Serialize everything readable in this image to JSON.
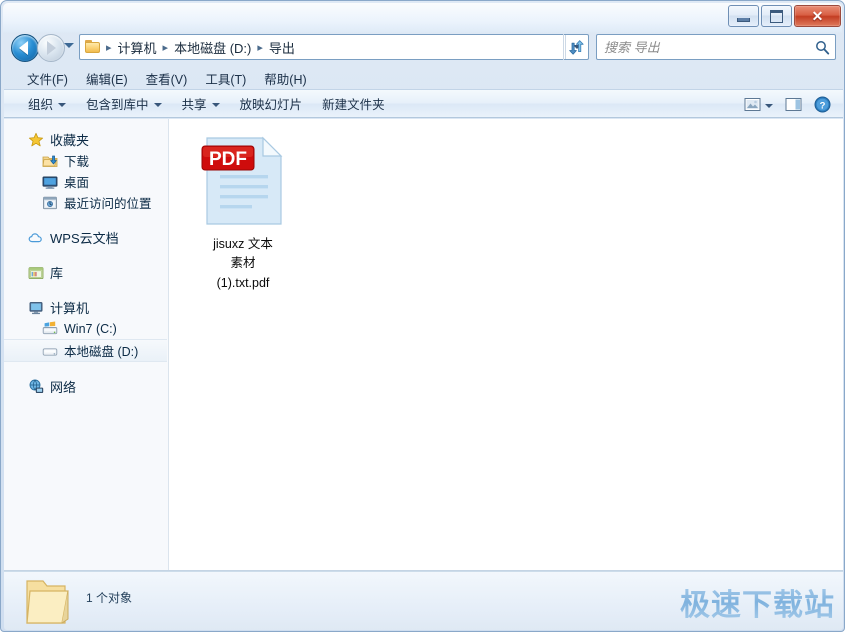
{
  "window": {
    "buttons": {
      "minimize": "minimize-button",
      "maximize": "maximize-button",
      "close_glyph": "✕"
    }
  },
  "nav": {
    "back_tooltip": "后退",
    "forward_tooltip": "前进",
    "history_tooltip": "最近浏览的页面",
    "refresh_tooltip": "刷新"
  },
  "address": {
    "crumbs": [
      "计算机",
      "本地磁盘 (D:)",
      "导出"
    ],
    "separator": "▸"
  },
  "search": {
    "placeholder": "搜索 导出",
    "value": ""
  },
  "menubar": {
    "items": [
      {
        "label": "文件(F)"
      },
      {
        "label": "编辑(E)"
      },
      {
        "label": "查看(V)"
      },
      {
        "label": "工具(T)"
      },
      {
        "label": "帮助(H)"
      }
    ]
  },
  "commandbar": {
    "items": [
      {
        "label": "组织",
        "has_chevron": true
      },
      {
        "label": "包含到库中",
        "has_chevron": true
      },
      {
        "label": "共享",
        "has_chevron": true
      },
      {
        "label": "放映幻灯片",
        "has_chevron": false
      },
      {
        "label": "新建文件夹",
        "has_chevron": false
      }
    ],
    "right": {
      "view_icon": "change-view-icon",
      "view_chevron": true,
      "preview_pane_icon": "preview-pane-icon",
      "help_icon": "help-icon"
    }
  },
  "navpane": {
    "groups": [
      {
        "name": "favorites",
        "nodes": [
          {
            "label": "收藏夹",
            "icon": "star-icon",
            "level": 0,
            "selected": false
          },
          {
            "label": "下载",
            "icon": "downloads-folder-icon",
            "level": 1,
            "selected": false
          },
          {
            "label": "桌面",
            "icon": "desktop-icon",
            "level": 1,
            "selected": false
          },
          {
            "label": "最近访问的位置",
            "icon": "recent-places-icon",
            "level": 1,
            "selected": false
          }
        ]
      },
      {
        "name": "wps-cloud",
        "nodes": [
          {
            "label": "WPS云文档",
            "icon": "cloud-icon",
            "level": 0,
            "selected": false
          }
        ]
      },
      {
        "name": "libraries",
        "nodes": [
          {
            "label": "库",
            "icon": "library-icon",
            "level": 0,
            "selected": false
          }
        ]
      },
      {
        "name": "computer",
        "nodes": [
          {
            "label": "计算机",
            "icon": "computer-icon",
            "level": 0,
            "selected": false
          },
          {
            "label": "Win7 (C:)",
            "icon": "system-drive-icon",
            "level": 1,
            "selected": false
          },
          {
            "label": "本地磁盘 (D:)",
            "icon": "drive-icon",
            "level": 1,
            "selected": true
          }
        ]
      },
      {
        "name": "network",
        "nodes": [
          {
            "label": "网络",
            "icon": "network-icon",
            "level": 0,
            "selected": false
          }
        ]
      }
    ]
  },
  "filelist": {
    "items": [
      {
        "name": "jisuxz 文本素材 (1).txt.pdf",
        "name_lines": [
          "jisuxz 文本",
          "素材",
          "(1).txt.pdf"
        ],
        "icon": "pdf-file-icon",
        "badge": "PDF"
      }
    ]
  },
  "statusbar": {
    "folder_icon": "open-folder-icon",
    "text": "1 个对象",
    "watermark": "极速下载站"
  },
  "colors": {
    "accent_blue": "#2a8fd4",
    "pdf_red": "#cc0000",
    "close_red": "#c33d22",
    "watermark_blue": "#8dbbe3",
    "folder_yellow": "#fbd276"
  }
}
